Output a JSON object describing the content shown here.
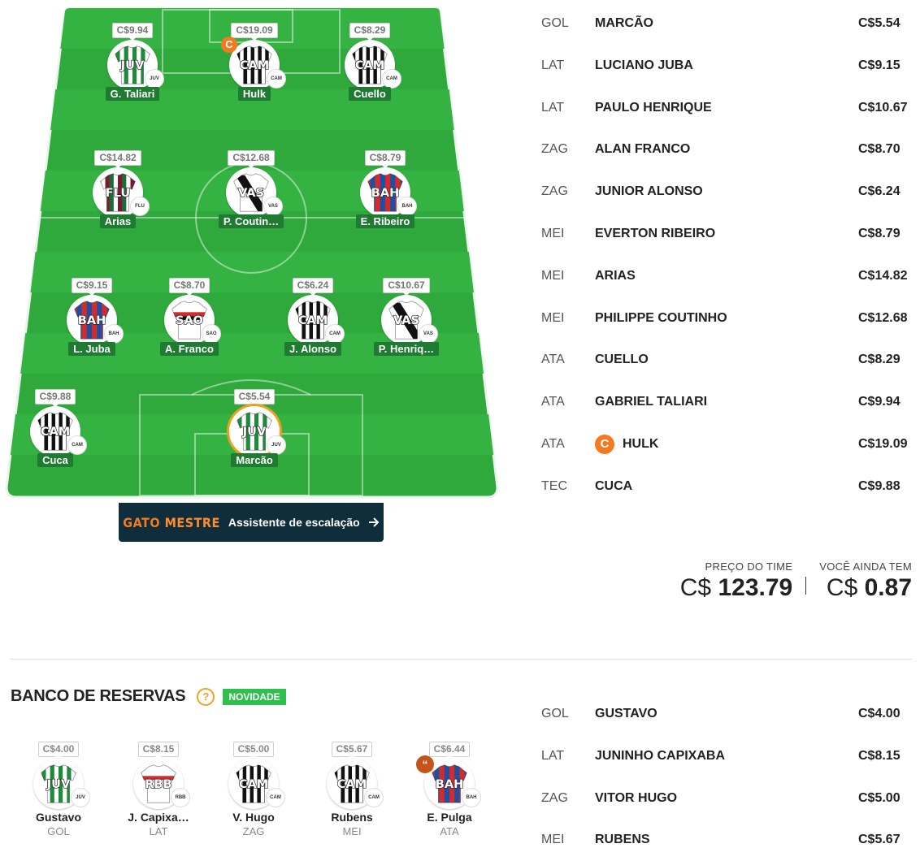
{
  "field": {
    "players": [
      {
        "name": "G. Taliari",
        "price": "C$9.94",
        "team": "JUV",
        "badge": "JUV",
        "kit": "juv"
      },
      {
        "name": "Hulk",
        "price": "C$19.09",
        "team": "CAM",
        "badge": "CAM",
        "kit": "cam",
        "captain": "C"
      },
      {
        "name": "Cuello",
        "price": "C$8.29",
        "team": "CAM",
        "badge": "CAM",
        "kit": "cam"
      },
      {
        "name": "Arias",
        "price": "C$14.82",
        "team": "FLU",
        "badge": "FLU",
        "kit": "flu"
      },
      {
        "name": "P. Coutin…",
        "price": "C$12.68",
        "team": "VAS",
        "badge": "VAS",
        "kit": "vas"
      },
      {
        "name": "E. Ribeiro",
        "price": "C$8.79",
        "team": "BAH",
        "badge": "BAH",
        "kit": "bah"
      },
      {
        "name": "L. Juba",
        "price": "C$9.15",
        "team": "BAH",
        "badge": "BAH",
        "kit": "bah"
      },
      {
        "name": "A. Franco",
        "price": "C$8.70",
        "team": "SAO",
        "badge": "SAO",
        "kit": "sao"
      },
      {
        "name": "J. Alonso",
        "price": "C$6.24",
        "team": "CAM",
        "badge": "CAM",
        "kit": "cam"
      },
      {
        "name": "P. Henriq…",
        "price": "C$10.67",
        "team": "VAS",
        "badge": "VAS",
        "kit": "vas"
      },
      {
        "name": "Cuca",
        "price": "C$9.88",
        "team": "CAM",
        "badge": "CAM",
        "kit": "cam"
      },
      {
        "name": "Marcão",
        "price": "C$5.54",
        "team": "JUV",
        "badge": "JUV",
        "kit": "juv",
        "highlight": true
      }
    ]
  },
  "gato_mestre": {
    "brand_part1": "GATO",
    "brand_part2": "MESTRE",
    "label": "Assistente de escalação",
    "icon": "arrow-right-icon"
  },
  "lineup": [
    {
      "pos": "GOL",
      "name": "MARCÃO",
      "price": "C$5.54"
    },
    {
      "pos": "LAT",
      "name": "LUCIANO JUBA",
      "price": "C$9.15"
    },
    {
      "pos": "LAT",
      "name": "PAULO HENRIQUE",
      "price": "C$10.67"
    },
    {
      "pos": "ZAG",
      "name": "ALAN FRANCO",
      "price": "C$8.70"
    },
    {
      "pos": "ZAG",
      "name": "JUNIOR ALONSO",
      "price": "C$6.24"
    },
    {
      "pos": "MEI",
      "name": "EVERTON RIBEIRO",
      "price": "C$8.79"
    },
    {
      "pos": "MEI",
      "name": "ARIAS",
      "price": "C$14.82"
    },
    {
      "pos": "MEI",
      "name": "PHILIPPE COUTINHO",
      "price": "C$12.68"
    },
    {
      "pos": "ATA",
      "name": "CUELLO",
      "price": "C$8.29"
    },
    {
      "pos": "ATA",
      "name": "GABRIEL TALIARI",
      "price": "C$9.94"
    },
    {
      "pos": "ATA",
      "name": "HULK",
      "price": "C$19.09",
      "captain": "C"
    },
    {
      "pos": "TEC",
      "name": "CUCA",
      "price": "C$9.88"
    }
  ],
  "summary": {
    "team_price_label": "PREÇO DO TIME",
    "currency": "C$",
    "team_price": "123.79",
    "remaining_label": "VOCÊ AINDA TEM",
    "remaining": "0.87"
  },
  "bench": {
    "title": "BANCO DE RESERVAS",
    "help": "?",
    "badge": "NOVIDADE",
    "players": [
      {
        "name": "Gustavo",
        "pos": "GOL",
        "price": "C$4.00",
        "team": "JUV",
        "badge": "JUV",
        "kit": "juv"
      },
      {
        "name": "J. Capixa…",
        "pos": "LAT",
        "price": "C$8.15",
        "team": "RBB",
        "badge": "RBB",
        "kit": "rbb"
      },
      {
        "name": "V. Hugo",
        "pos": "ZAG",
        "price": "C$5.00",
        "team": "CAM",
        "badge": "CAM",
        "kit": "cam"
      },
      {
        "name": "Rubens",
        "pos": "MEI",
        "price": "C$5.67",
        "team": "CAM",
        "badge": "CAM",
        "kit": "cam"
      },
      {
        "name": "E. Pulga",
        "pos": "ATA",
        "price": "C$6.44",
        "team": "BAH",
        "badge": "BAH",
        "kit": "bah",
        "reserve_mark": "“"
      }
    ],
    "list": [
      {
        "pos": "GOL",
        "name": "GUSTAVO",
        "price": "C$4.00"
      },
      {
        "pos": "LAT",
        "name": "JUNINHO CAPIXABA",
        "price": "C$8.15"
      },
      {
        "pos": "ZAG",
        "name": "VITOR HUGO",
        "price": "C$5.00"
      },
      {
        "pos": "MEI",
        "name": "RUBENS",
        "price": "C$5.67"
      }
    ]
  },
  "colors": {
    "field_green": "#2fa83c",
    "field_stripe": "#35b342",
    "captain": "#f47a20",
    "name_tag": "#1f7a32",
    "gato_bg": "#0f2d3a",
    "novidade": "#2fbf4e"
  }
}
